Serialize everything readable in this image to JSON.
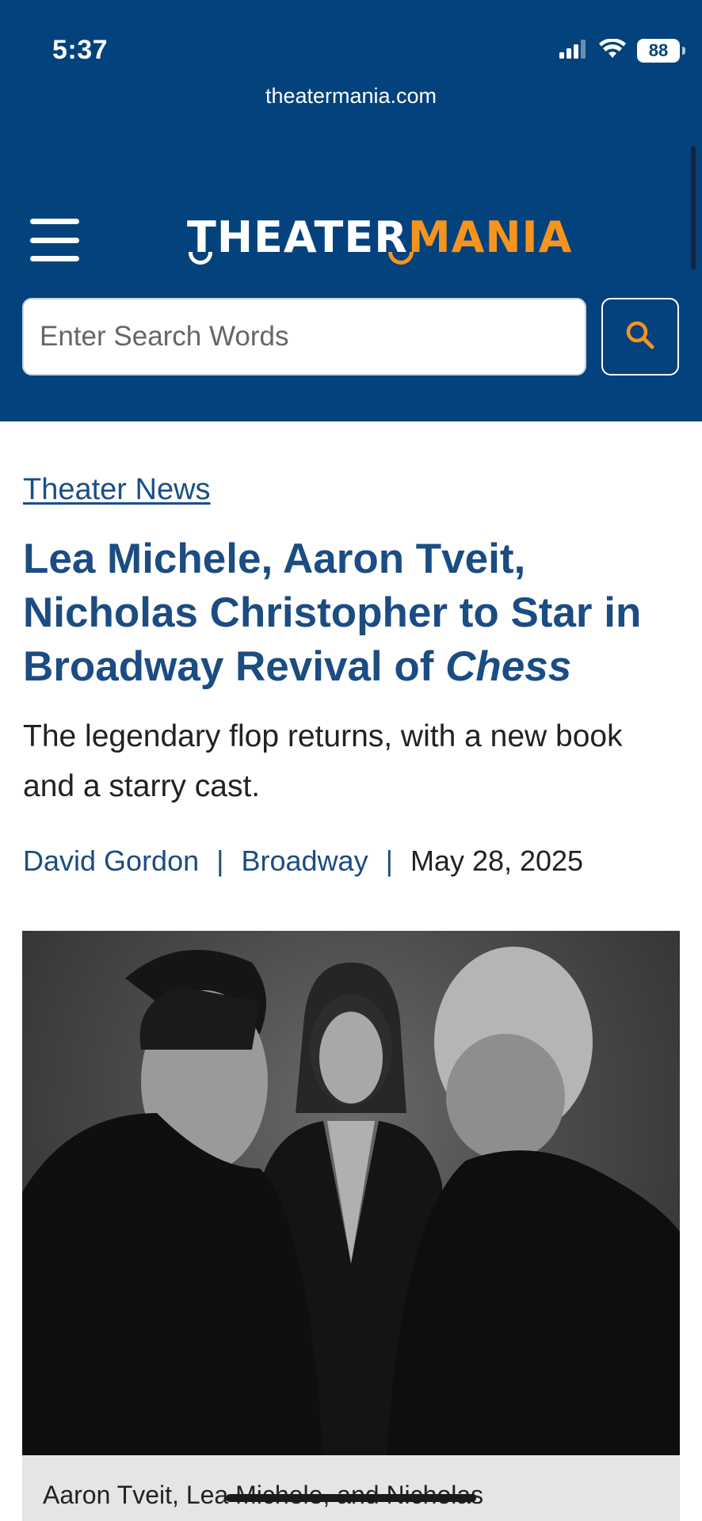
{
  "status_bar": {
    "time": "5:37",
    "battery": "88",
    "icons": [
      "cellular-signal-icon",
      "wifi-icon",
      "battery-icon"
    ]
  },
  "browser": {
    "url": "theatermania.com"
  },
  "header": {
    "logo_part1": "THEATER",
    "logo_part2": "MANIA",
    "menu_icon": "hamburger-menu-icon",
    "colors": {
      "background": "#04427d",
      "accent": "#f7941d"
    }
  },
  "search": {
    "placeholder": "Enter Search Words",
    "value": "",
    "button_icon": "search-icon"
  },
  "article": {
    "section": "Theater News",
    "headline_main": "Lea Michele, Aaron Tveit, Nicholas Christopher to Star in Broadway Revival of ",
    "headline_italic": "Chess",
    "dek": "The legendary flop returns, with a new book and a starry cast.",
    "author": "David Gordon",
    "category": "Broadway",
    "date": "May 28, 2025",
    "separator": "|",
    "caption": "Aaron Tveit, Lea Michele, and Nicholas"
  }
}
